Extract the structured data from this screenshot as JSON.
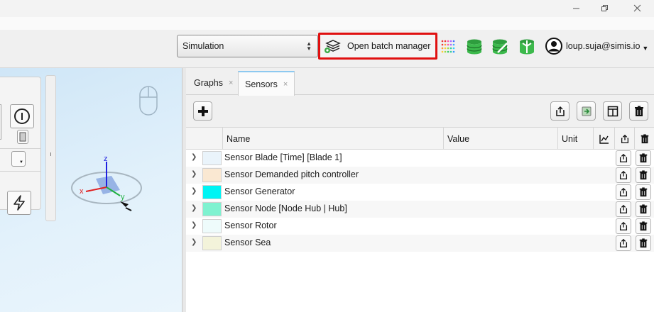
{
  "toolbar": {
    "simulation_select": "Simulation",
    "batch_button_label": "Open batch manager",
    "user_email": "loup.suja@simis.io"
  },
  "tabs": [
    {
      "label": "Graphs",
      "close": "×"
    },
    {
      "label": "Sensors",
      "close": "×"
    }
  ],
  "viewport": {
    "axis_x": "x",
    "axis_y": "y",
    "axis_z": "z"
  },
  "table": {
    "columns": {
      "name": "Name",
      "value": "Value",
      "unit": "Unit"
    },
    "rows": [
      {
        "name": "Sensor Blade [Time] [Blade 1]",
        "color": "#eaf4fb"
      },
      {
        "name": "Sensor Demanded pitch controller",
        "color": "#fae8d2"
      },
      {
        "name": "Sensor Generator",
        "color": "#00f4f4"
      },
      {
        "name": "Sensor Node [Node Hub | Hub]",
        "color": "#7ff2d0"
      },
      {
        "name": "Sensor Rotor",
        "color": "#eefbfb"
      },
      {
        "name": "Sensor Sea",
        "color": "#f3f3da"
      }
    ]
  },
  "colors": {
    "highlight_border": "#e01010",
    "active_tab_accent": "#8dc9f0"
  }
}
